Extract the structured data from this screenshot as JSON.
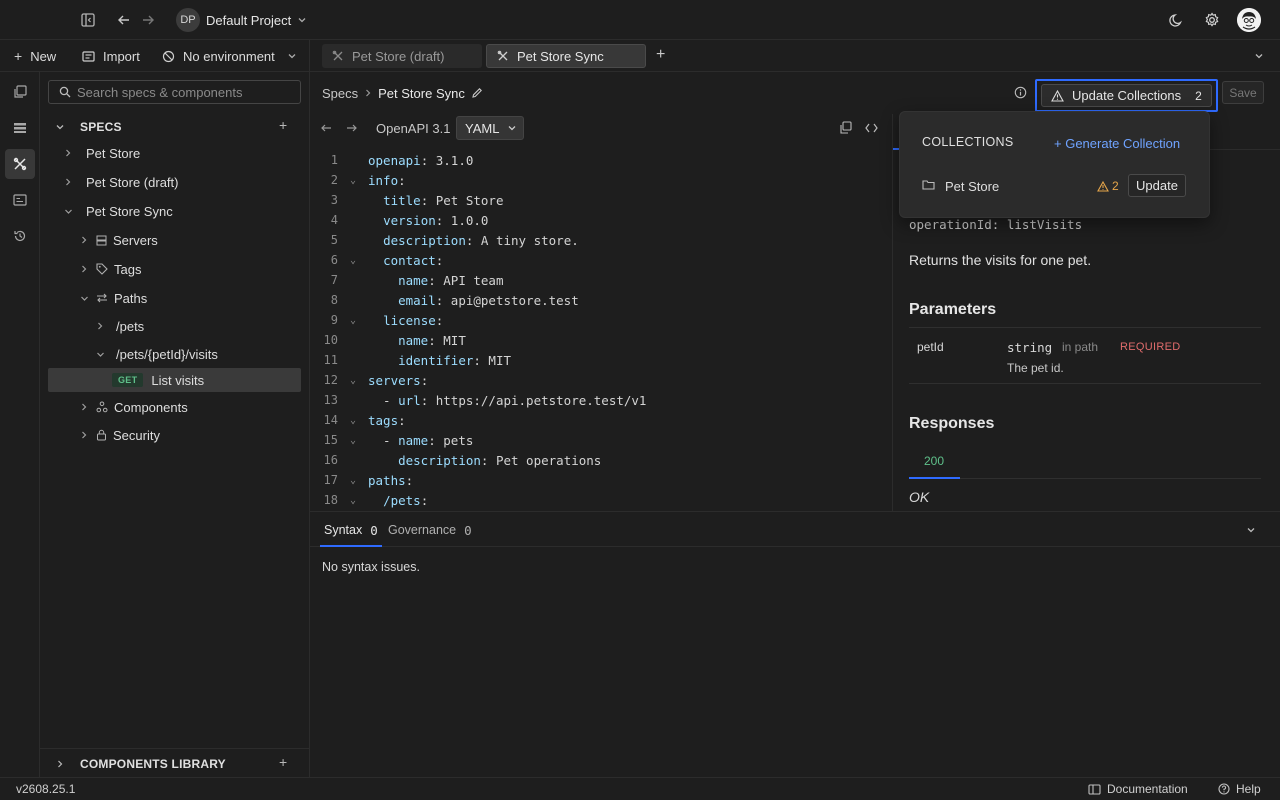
{
  "header": {
    "project_initials": "DP",
    "project_name": "Default Project"
  },
  "actions": {
    "new_label": "New",
    "import_label": "Import",
    "environment_label": "No environment"
  },
  "tabs": [
    {
      "label": "Pet Store (draft)",
      "active": false
    },
    {
      "label": "Pet Store Sync",
      "active": true
    }
  ],
  "sidebar": {
    "search_placeholder": "Search specs & components",
    "specs_header": "SPECS",
    "tree": {
      "pet_store": "Pet Store",
      "pet_store_draft": "Pet Store (draft)",
      "pet_store_sync": "Pet Store Sync",
      "servers": "Servers",
      "tags": "Tags",
      "paths": "Paths",
      "path_pets": "/pets",
      "path_visits": "/pets/{petId}/visits",
      "method": "GET",
      "operation": "List visits",
      "components": "Components",
      "security": "Security"
    },
    "library_header": "COMPONENTS LIBRARY"
  },
  "breadcrumb": {
    "root": "Specs",
    "current": "Pet Store Sync"
  },
  "update_button": {
    "label": "Update Collections",
    "count": "2"
  },
  "save_label": "Save",
  "editor": {
    "version": "OpenAPI 3.1",
    "format": "YAML",
    "lines": [
      {
        "n": "1",
        "fold": false,
        "indent": "",
        "key": "openapi",
        "rest": ": 3.1.0"
      },
      {
        "n": "2",
        "fold": true,
        "indent": "",
        "key": "info",
        "rest": ":"
      },
      {
        "n": "3",
        "fold": false,
        "indent": "  ",
        "key": "title",
        "rest": ": Pet Store"
      },
      {
        "n": "4",
        "fold": false,
        "indent": "  ",
        "key": "version",
        "rest": ": 1.0.0"
      },
      {
        "n": "5",
        "fold": false,
        "indent": "  ",
        "key": "description",
        "rest": ": A tiny store."
      },
      {
        "n": "6",
        "fold": true,
        "indent": "  ",
        "key": "contact",
        "rest": ":"
      },
      {
        "n": "7",
        "fold": false,
        "indent": "    ",
        "key": "name",
        "rest": ": API team"
      },
      {
        "n": "8",
        "fold": false,
        "indent": "    ",
        "key": "email",
        "rest": ": api@petstore.test"
      },
      {
        "n": "9",
        "fold": true,
        "indent": "  ",
        "key": "license",
        "rest": ":"
      },
      {
        "n": "10",
        "fold": false,
        "indent": "    ",
        "key": "name",
        "rest": ": MIT"
      },
      {
        "n": "11",
        "fold": false,
        "indent": "    ",
        "key": "identifier",
        "rest": ": MIT"
      },
      {
        "n": "12",
        "fold": true,
        "indent": "",
        "key": "servers",
        "rest": ":"
      },
      {
        "n": "13",
        "fold": false,
        "indent": "  - ",
        "key": "url",
        "rest": ": https://api.petstore.test/v1"
      },
      {
        "n": "14",
        "fold": true,
        "indent": "",
        "key": "tags",
        "rest": ":"
      },
      {
        "n": "15",
        "fold": true,
        "indent": "  - ",
        "key": "name",
        "rest": ": pets"
      },
      {
        "n": "16",
        "fold": false,
        "indent": "    ",
        "key": "description",
        "rest": ": Pet operations"
      },
      {
        "n": "17",
        "fold": true,
        "indent": "",
        "key": "paths",
        "rest": ":"
      },
      {
        "n": "18",
        "fold": true,
        "indent": "  ",
        "key": "/pets",
        "rest": ":"
      }
    ]
  },
  "preview": {
    "operation_id": "operationId: listVisits",
    "description": "Returns the visits for one pet.",
    "parameters_title": "Parameters",
    "param_name": "petId",
    "param_type": "string",
    "param_location": "in path",
    "param_required": "REQUIRED",
    "param_description": "The pet id.",
    "responses_title": "Responses",
    "response_code": "200",
    "response_description": "OK"
  },
  "popover": {
    "title": "COLLECTIONS",
    "generate_label": "+ Generate Collection",
    "collection_name": "Pet Store",
    "warning_count": "2",
    "update_label": "Update"
  },
  "bottom": {
    "syntax_label": "Syntax",
    "syntax_count": "0",
    "governance_label": "Governance",
    "governance_count": "0",
    "message": "No syntax issues."
  },
  "footer": {
    "version": "v2608.25.1",
    "documentation_label": "Documentation",
    "help_label": "Help"
  },
  "colors": {
    "accent": "#2f6bff",
    "link": "#6fa3ff",
    "warning": "#e5a54a",
    "required": "#e06c6c",
    "success": "#5fc08a"
  }
}
